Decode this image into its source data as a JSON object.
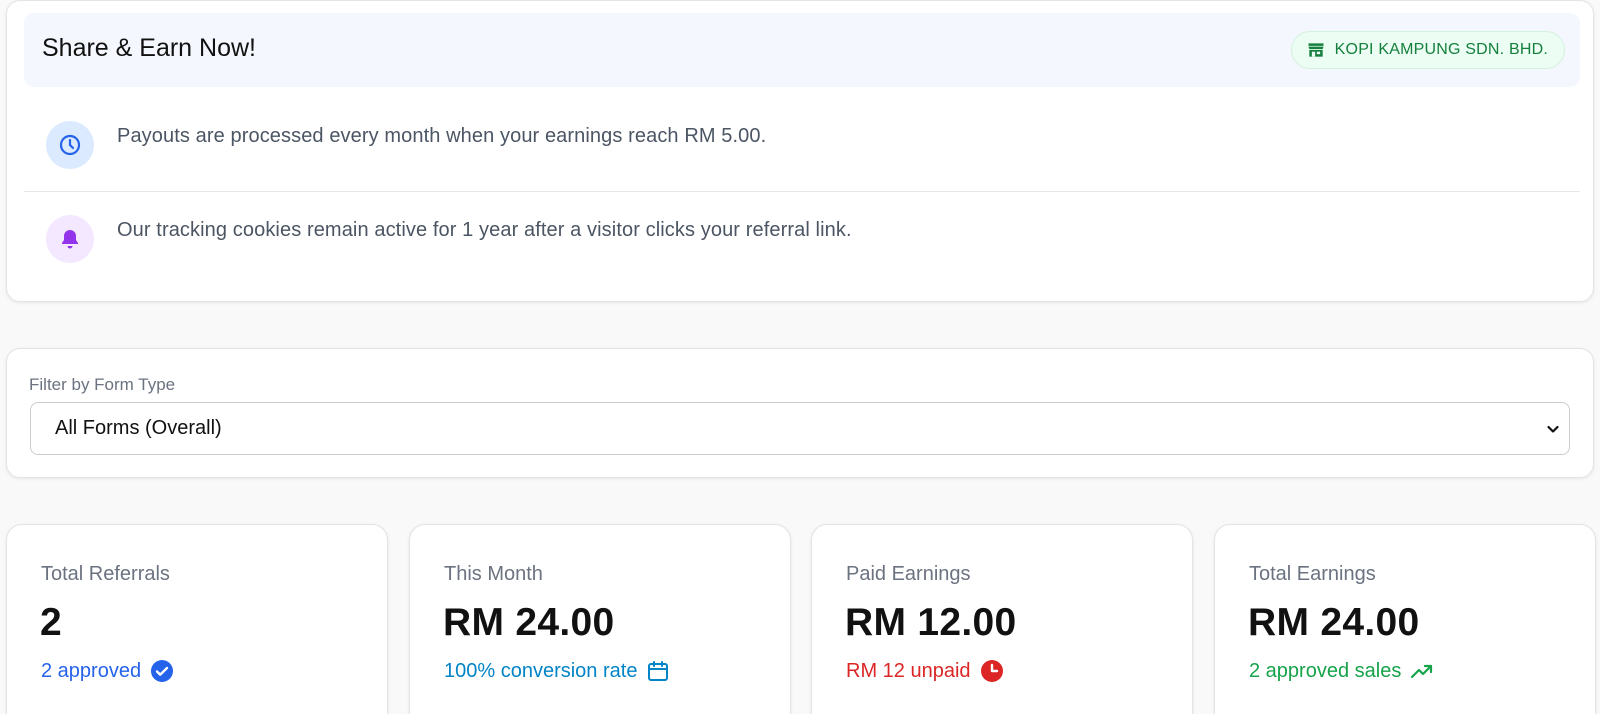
{
  "info": {
    "title": "Share & Earn Now!",
    "company": "KOPI KAMPUNG SDN. BHD.",
    "notes": [
      {
        "icon": "clock-icon",
        "text": "Payouts are processed every month when your earnings reach RM 5.00."
      },
      {
        "icon": "bell-icon",
        "text": "Our tracking cookies remain active for 1 year after a visitor clicks your referral link."
      }
    ]
  },
  "filter": {
    "label": "Filter by Form Type",
    "selected": "All Forms (Overall)"
  },
  "stats": [
    {
      "label": "Total Referrals",
      "value": "2",
      "sub": "2 approved",
      "icon": "check-badge-icon",
      "color": "#2563eb"
    },
    {
      "label": "This Month",
      "value": "RM 24.00",
      "sub": "100% conversion rate",
      "icon": "calendar-icon",
      "color": "#0284c7"
    },
    {
      "label": "Paid Earnings",
      "value": "RM 12.00",
      "sub": "RM 12 unpaid",
      "icon": "clock-filled-icon",
      "color": "#dc2626"
    },
    {
      "label": "Total Earnings",
      "value": "RM 24.00",
      "sub": "2 approved sales",
      "icon": "trending-up-icon",
      "color": "#16a34a"
    }
  ],
  "colors": {
    "accent_blue": "#2563eb",
    "badge_green": "#15803d",
    "header_bg": "#f5f7ff"
  }
}
